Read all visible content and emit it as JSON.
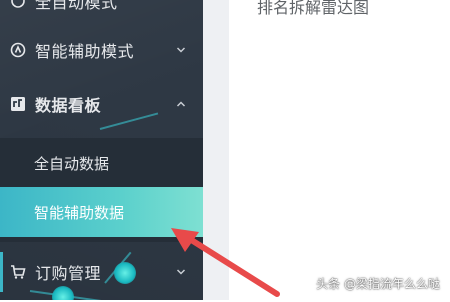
{
  "sidebar": {
    "items": [
      {
        "label": "全自动模式",
        "icon": "auto-mode-icon"
      },
      {
        "label": "智能辅助模式",
        "icon": "assist-mode-icon"
      },
      {
        "label": "数据看板",
        "icon": "dashboard-icon",
        "children": [
          {
            "label": "全自动数据"
          },
          {
            "label": "智能辅助数据",
            "active": true
          }
        ]
      },
      {
        "label": "订购管理",
        "icon": "cart-icon"
      }
    ]
  },
  "content": {
    "title": "排名拆解雷达图"
  },
  "watermark": {
    "text": "头条 @梁指流年么么哒"
  },
  "colors": {
    "sidebar_bg": "#2e3844",
    "submenu_bg": "#252e38",
    "active_gradient_start": "#3cb6c7",
    "active_gradient_end": "#7ee0d2",
    "arrow": "#e84a4a"
  }
}
